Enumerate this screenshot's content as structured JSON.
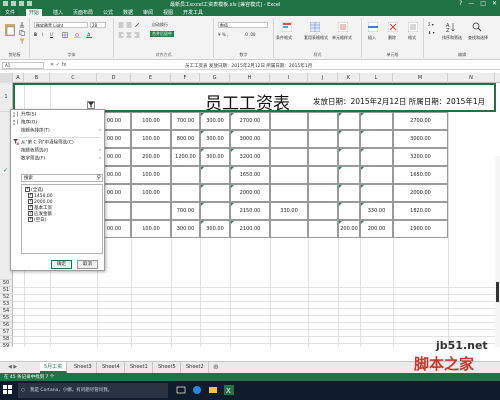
{
  "window": {
    "title": "最新员工excel工资表模板.xls [兼容模式] - Excel",
    "controls": [
      "?",
      "—",
      "□",
      "✕"
    ]
  },
  "ribbon_tabs": [
    "文件",
    "开始",
    "插入",
    "页面布局",
    "公式",
    "数据",
    "审阅",
    "视图",
    "开发工具"
  ],
  "ribbon": {
    "font_name": "微软雅黑 Light",
    "font_size": "28",
    "number_format": "数值",
    "wrap_label": "自动换行",
    "merge_label": "合并后居中",
    "groups": [
      "剪贴板",
      "字体",
      "对齐方式",
      "数字",
      "样式",
      "单元格",
      "编辑"
    ],
    "style_labels": [
      "条件格式",
      "套用表格格式",
      "单元格样式"
    ],
    "cell_labels": [
      "插入",
      "删除",
      "格式"
    ],
    "edit_labels": [
      "排序和筛选",
      "查找和选择"
    ]
  },
  "formula_bar": {
    "name_box": "A1",
    "fx": "fx",
    "content": "员工工资表   发放日期：2015年2月12日   所属日期：2015年1月"
  },
  "columns": [
    "A",
    "B",
    "C",
    "D",
    "E",
    "F",
    "G",
    "H",
    "I",
    "J",
    "K",
    "L",
    "M",
    "N"
  ],
  "banner": {
    "title": "员工工资表",
    "subtitle": "发放日期：2015年2月12日  所属日期：2015年1月"
  },
  "rows": [
    {
      "D": "00.00",
      "E": "100.00",
      "F": "700.00",
      "G": "300.00",
      "H": "2700.00",
      "M": "2700.00"
    },
    {
      "D": "00.00",
      "E": "100.00",
      "F": "800.00",
      "G": "300.00",
      "H": "3000.00",
      "M": "3000.00"
    },
    {
      "D": "00.00",
      "E": "200.00",
      "F": "1200.00",
      "G": "300.00",
      "H": "3200.00",
      "M": "3200.00"
    },
    {
      "D": "00.00",
      "E": "100.00",
      "F": "",
      "G": "",
      "H": "1650.00",
      "M": "1650.00"
    },
    {
      "D": "00.00",
      "E": "100.00",
      "F": "",
      "G": "",
      "H": "2000.00",
      "M": "2000.00"
    },
    {
      "D": "",
      "E": "",
      "F": "700.00",
      "G": "",
      "H": "2150.00",
      "I": "330.00",
      "L": "330.00",
      "M": "1820.00"
    },
    {
      "D": "00.00",
      "E": "100.00",
      "F": "300.00",
      "G": "300.00",
      "H": "2100.00",
      "K": "200.00",
      "L": "200.00",
      "M": "1900.00"
    }
  ],
  "row_numbers": {
    "first": "1",
    "lower": [
      "50",
      "51",
      "52",
      "53",
      "54",
      "55",
      "56",
      "57",
      "58",
      "59",
      "60"
    ]
  },
  "filter_menu": {
    "items": [
      "升序(S)",
      "降序(O)",
      "按颜色排序(T)",
      "从\"第 C 列\"中清除筛选(C)",
      "按颜色筛选(I)",
      "数字筛选(F)"
    ],
    "search_placeholder": "搜索",
    "options": [
      "(全选)",
      "1450.00",
      "2000.00",
      "基本工资",
      "应发金额",
      "(空白)"
    ],
    "ok_label": "确定",
    "cancel_label": "取消"
  },
  "sheet_tabs": [
    "5月工资",
    "Sheet3",
    "Sheet4",
    "Sheet1",
    "Sheet5",
    "Sheet2"
  ],
  "active_sheet": "5月工资",
  "status_text": "在 45 条记录中找到 7 个",
  "taskbar": {
    "search_placeholder": "我是 Cortana，小娜。有问题尽管问我。"
  },
  "watermark": {
    "site": "jb51.net",
    "name": "脚本之家"
  },
  "colors": {
    "excel_green": "#217346",
    "taskbar": "#101c2c",
    "watermark_red": "#c0392b"
  }
}
